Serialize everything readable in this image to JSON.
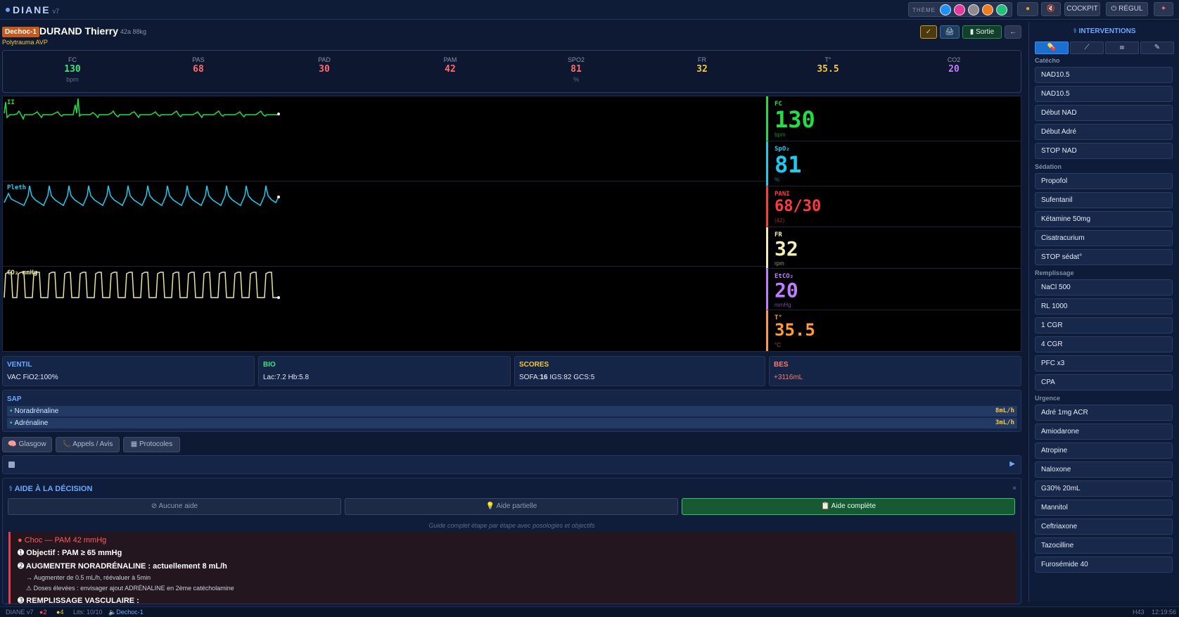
{
  "app": {
    "name": "DIANE",
    "version": "v7"
  },
  "topbar": {
    "theme_label": "THÈME",
    "cockpit_label": "COCKPIT",
    "regul_label": "RÉGUL",
    "theme_colors": [
      "#1e90ff",
      "#e6399b",
      "#8c8c8c",
      "#f07c1c",
      "#20c27a"
    ]
  },
  "patient": {
    "bed": "Dechoc-1",
    "name": "DURAND Thierry",
    "info": "42a 88kg",
    "diagnosis": "Polytrauma AVP"
  },
  "header_buttons": {
    "check": "✓",
    "print": "🖨",
    "sortie": "Sortie",
    "back": "←"
  },
  "vitals": [
    {
      "name": "FC",
      "value": "130",
      "unit": "bpm",
      "color": "#44e07a"
    },
    {
      "name": "PAS",
      "value": "68",
      "unit": "",
      "color": "#ff6b6b"
    },
    {
      "name": "PAD",
      "value": "30",
      "unit": "",
      "color": "#ff6b6b"
    },
    {
      "name": "PAM",
      "value": "42",
      "unit": "",
      "color": "#ff6b6b"
    },
    {
      "name": "SPO2",
      "value": "81",
      "unit": "%",
      "color": "#ff6b6b"
    },
    {
      "name": "FR",
      "value": "32",
      "unit": "",
      "color": "#f5c842"
    },
    {
      "name": "T°",
      "value": "35.5",
      "unit": "",
      "color": "#f5c842"
    },
    {
      "name": "CO2",
      "value": "20",
      "unit": "",
      "color": "#c07dff"
    }
  ],
  "monitor": {
    "waves": [
      {
        "label": "II",
        "color": "#22dd44"
      },
      {
        "label": "Pleth",
        "color": "#1ecbf0"
      },
      {
        "label": "CO₂ mmHg",
        "color": "#ede6a0"
      }
    ],
    "values": [
      {
        "label": "FC",
        "value": "130",
        "unit": "bpm",
        "color": "#22dd44"
      },
      {
        "label": "SpO₂",
        "value": "81",
        "unit": "%",
        "color": "#1ecbf0"
      },
      {
        "label": "PANI",
        "value": "68/30",
        "unit": "(42)",
        "color": "#ff3b3b"
      },
      {
        "label": "FR",
        "value": "32",
        "unit": "rpm",
        "color": "#f3efb4"
      },
      {
        "label": "EtCO₂",
        "value": "20",
        "unit": "mmHg",
        "color": "#c07dff"
      },
      {
        "label": "T°",
        "value": "35.5",
        "unit": "°C",
        "color": "#ff9b3d"
      }
    ]
  },
  "panels": {
    "ventil": {
      "title": "VENTIL",
      "content": "VAC FiO2:100%"
    },
    "bio": {
      "title": "BIO",
      "content": "Lac:7.2 Hb:5.8"
    },
    "scores": {
      "title": "SCORES",
      "prefix": "SOFA:",
      "sofa": "16",
      "rest": "IGS:82 GCS:5"
    },
    "bes": {
      "title": "BES",
      "content": "+3116mL"
    }
  },
  "sap": {
    "title": "SAP",
    "rows": [
      {
        "name": "Noradrénaline",
        "rate": "8mL/h"
      },
      {
        "name": "Adrénaline",
        "rate": "3mL/h"
      }
    ]
  },
  "tabs": [
    {
      "label": "Glasgow",
      "icon": "🧠"
    },
    {
      "label": "Appels / Avis",
      "icon": "📞"
    },
    {
      "label": "Protocoles",
      "icon": "▦"
    }
  ],
  "aide": {
    "title": "AIDE À LA DÉCISION",
    "close": "×",
    "modes": [
      {
        "label": "Aucune aide",
        "icon": "⊘"
      },
      {
        "label": "Aide partielle",
        "icon": "💡"
      },
      {
        "label": "Aide complète",
        "icon": "📋"
      }
    ],
    "hint": "Guide complet étape par étape avec posologies et objectifs",
    "alert_title": "Choc — PAM 42 mmHg",
    "step1": "Objectif : PAM ≥ 65 mmHg",
    "step2": "AUGMENTER NORADRÉNALINE : actuellement 8 mL/h",
    "step2_sub1": "→ Augmenter de 0.5 mL/h, réévaluer à 5min",
    "step2_sub2": "⚠ Doses élevées : envisager ajout ADRÉNALINE en 2ème catécholamine",
    "step3": "REMPLISSAGE VASCULAIRE :"
  },
  "interventions": {
    "title": "INTERVENTIONS",
    "sections": [
      {
        "title": "Catécho",
        "items": [
          "NAD10.5",
          "NAD10.5",
          "Début NAD",
          "Début Adré",
          "STOP NAD"
        ]
      },
      {
        "title": "Sédation",
        "items": [
          "Propofol",
          "Sufentanil",
          "Kétamine 50mg",
          "Cisatracurium",
          "STOP sédat°"
        ]
      },
      {
        "title": "Remplissage",
        "items": [
          "NaCl 500",
          "RL 1000",
          "1 CGR",
          "4 CGR",
          "PFC x3",
          "CPA"
        ]
      },
      {
        "title": "Urgence",
        "items": [
          "Adré 1mg ACR",
          "Amiodarone",
          "Atropine",
          "Naloxone",
          "G30% 20mL",
          "Mannitol",
          "Ceftriaxone",
          "Tazocilline",
          "Furosémide 40"
        ]
      }
    ]
  },
  "statusbar": {
    "app": "DIANE v7",
    "red_count": "2",
    "yellow_count": "4",
    "beds": "Lits: 10/10",
    "bed": "Dechoc-1",
    "code": "H43",
    "time": "12:19:56"
  }
}
